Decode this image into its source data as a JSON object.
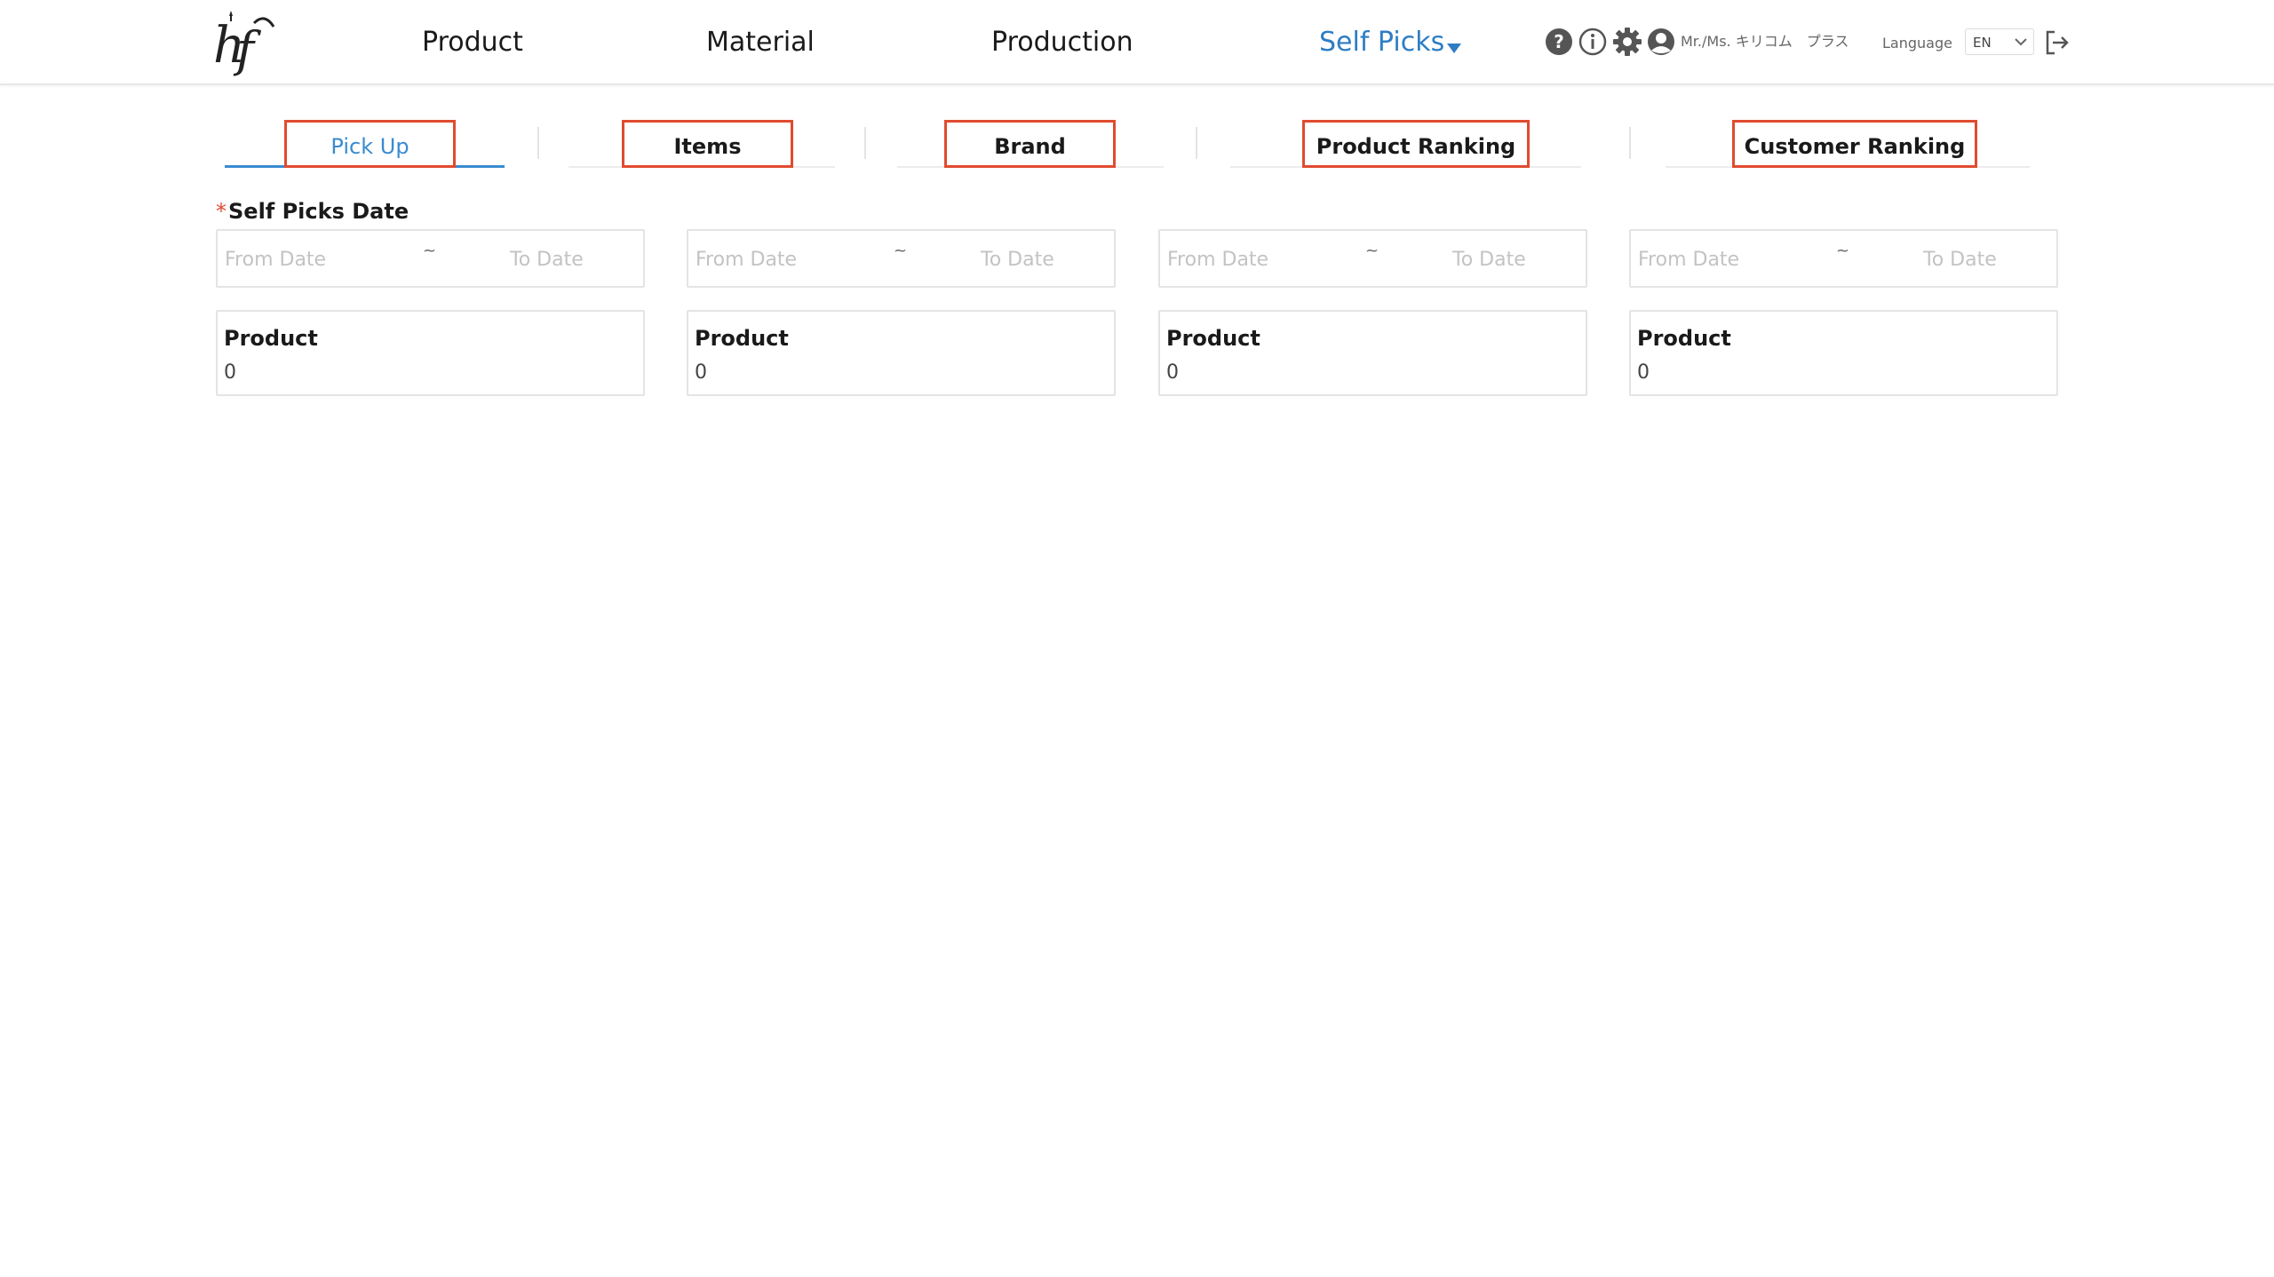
{
  "header": {
    "logo_text": "htf",
    "nav": {
      "product": "Product",
      "material": "Material",
      "production": "Production",
      "self_picks": "Self Picks"
    },
    "icons": {
      "help": "question-circle-icon",
      "info": "info-circle-icon",
      "settings": "gear-icon",
      "user": "user-circle-icon",
      "logout": "logout-icon"
    },
    "username": "Mr./Ms. キリコム　プラス",
    "language_label": "Language",
    "language_value": "EN"
  },
  "tabs": [
    {
      "label": "Pick Up",
      "active": true
    },
    {
      "label": "Items",
      "active": false
    },
    {
      "label": "Brand",
      "active": false
    },
    {
      "label": "Product Ranking",
      "active": false
    },
    {
      "label": "Customer Ranking",
      "active": false
    }
  ],
  "filter": {
    "required_mark": "*",
    "date_label": "Self Picks Date",
    "date_ranges": [
      {
        "from_placeholder": "From Date",
        "separator": "~",
        "to_placeholder": "To Date"
      },
      {
        "from_placeholder": "From Date",
        "separator": "~",
        "to_placeholder": "To Date"
      },
      {
        "from_placeholder": "From Date",
        "separator": "~",
        "to_placeholder": "To Date"
      },
      {
        "from_placeholder": "From Date",
        "separator": "~",
        "to_placeholder": "To Date"
      }
    ],
    "product_boxes": [
      {
        "title": "Product",
        "value": "0"
      },
      {
        "title": "Product",
        "value": "0"
      },
      {
        "title": "Product",
        "value": "0"
      },
      {
        "title": "Product",
        "value": "0"
      }
    ]
  },
  "colors": {
    "accent": "#2e7dc4",
    "tab_active": "#3a8bd1",
    "highlight_border": "#e04b2f",
    "border": "#e4e4e4"
  }
}
